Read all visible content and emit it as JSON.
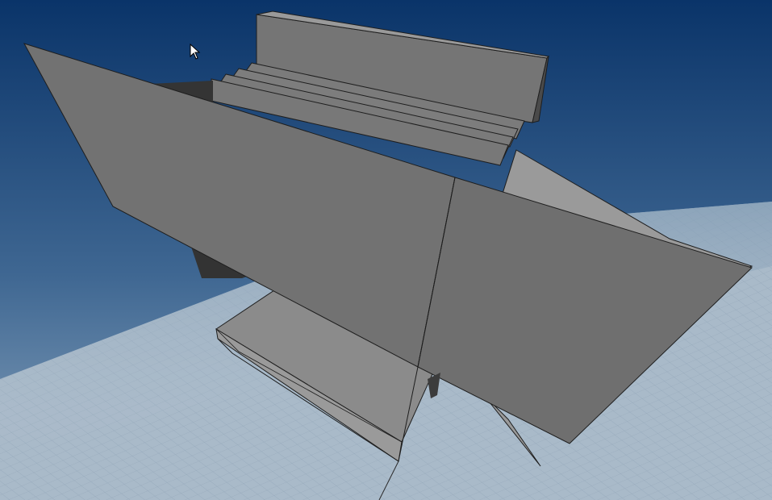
{
  "viewport": {
    "background_top": "#0a3469",
    "background_bottom": "#8aa5be"
  },
  "scene": {
    "grid_color": "#9fb2c4",
    "grid_fill": "#a9bac9",
    "face_light": "#8e8e8e",
    "face_mid": "#767676",
    "face_dark": "#3a3a3a",
    "edge_color": "#1e1e1e"
  },
  "cursor": {
    "icon": "arrow-pointer-icon"
  }
}
